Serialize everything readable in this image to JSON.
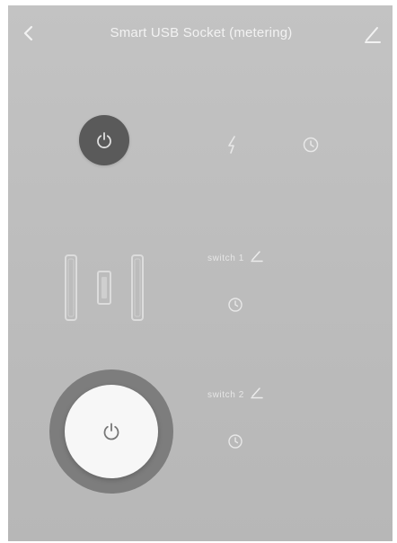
{
  "header": {
    "title": "Smart USB Socket (metering)",
    "back_icon": "chevron-left-icon",
    "edit_icon": "pencil-icon"
  },
  "controls": {
    "master_power_icon": "power-icon",
    "master_power_state": "off",
    "electricity_icon": "lightning-icon",
    "timer_icon": "clock-icon"
  },
  "switches": [
    {
      "label": "switch 1",
      "edit_icon": "pencil-icon",
      "timer_icon": "clock-icon"
    },
    {
      "label": "switch 2",
      "edit_icon": "pencil-icon",
      "timer_icon": "clock-icon",
      "power_icon": "power-icon",
      "state": "on"
    }
  ],
  "colors": {
    "background": "#bdbdbd",
    "master_power_bg": "#5a5a5a",
    "big_power_ring": "#7d7d7d",
    "big_power_face": "#f7f7f7",
    "icon_light": "#e8e8e8"
  }
}
